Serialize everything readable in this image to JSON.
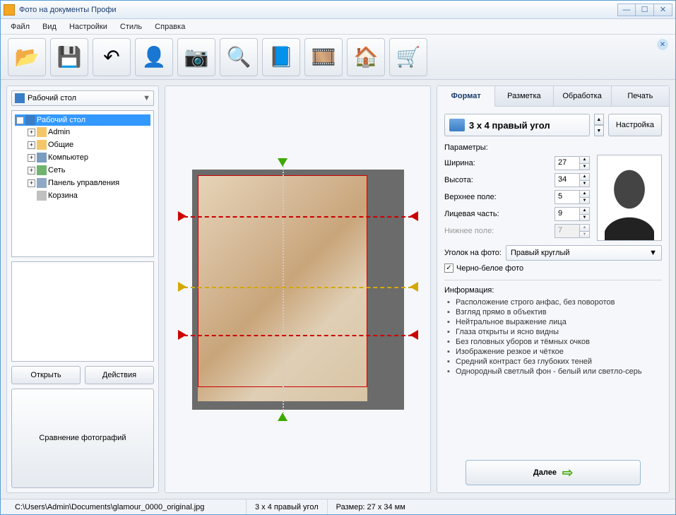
{
  "title": "Фото на документы Профи",
  "menu": [
    "Файл",
    "Вид",
    "Настройки",
    "Стиль",
    "Справка"
  ],
  "toolbar_icons": [
    "folder-open",
    "save",
    "undo",
    "person-search",
    "camera",
    "image-search",
    "help-book",
    "film-settings",
    "home",
    "cart"
  ],
  "left": {
    "root_combo": "Рабочий стол",
    "tree": {
      "root": "Рабочий стол",
      "children": [
        {
          "label": "Admin",
          "icon": "folder",
          "expandable": true
        },
        {
          "label": "Общие",
          "icon": "folder",
          "expandable": true
        },
        {
          "label": "Компьютер",
          "icon": "computer",
          "expandable": true
        },
        {
          "label": "Сеть",
          "icon": "network",
          "expandable": true
        },
        {
          "label": "Панель управления",
          "icon": "cpanel",
          "expandable": true
        },
        {
          "label": "Корзина",
          "icon": "trash",
          "expandable": false
        }
      ]
    },
    "open_btn": "Открыть",
    "actions_btn": "Действия",
    "compare_btn": "Сравнение фотографий"
  },
  "tabs": [
    "Формат",
    "Разметка",
    "Обработка",
    "Печать"
  ],
  "active_tab": 0,
  "format": {
    "selected": "3 x 4 правый угол",
    "settings_btn": "Настройка",
    "params_title": "Параметры:",
    "params": {
      "width_label": "Ширина:",
      "width": "27",
      "height_label": "Высота:",
      "height": "34",
      "top_label": "Верхнее поле:",
      "top": "5",
      "face_label": "Лицевая часть:",
      "face": "9",
      "bottom_label": "Нижнее поле:",
      "bottom": "7"
    },
    "corner_label": "Уголок на фото:",
    "corner_value": "Правый круглый",
    "bw_checkbox": "Черно-белое фото",
    "bw_checked": true,
    "info_title": "Информация:",
    "info": [
      "Расположение строго анфас, без поворотов",
      "Взгляд прямо в объектив",
      "Нейтральное выражение лица",
      "Глаза открыты и ясно видны",
      "Без головных уборов и тёмных очков",
      "Изображение резкое и чёткое",
      "Средний контраст без глубоких теней",
      "Однородный светлый фон - белый или светло-серь"
    ],
    "next_btn": "Далее"
  },
  "status": {
    "path": "C:\\Users\\Admin\\Documents\\glamour_0000_original.jpg",
    "format": "3 x 4 правый угол",
    "size": "Размер: 27 x 34 мм"
  }
}
